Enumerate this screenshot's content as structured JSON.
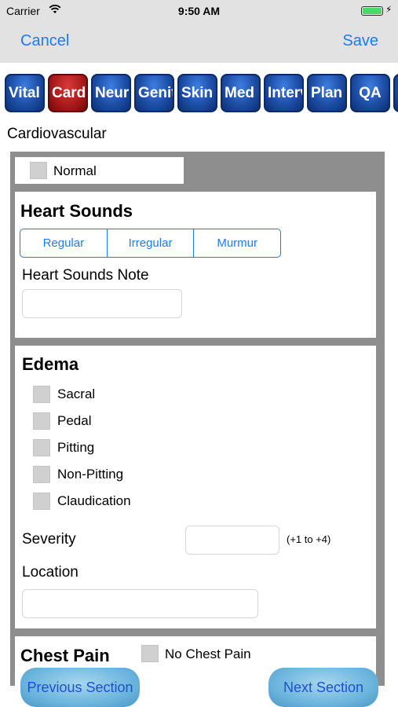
{
  "status_bar": {
    "carrier": "Carrier",
    "time": "9:50 AM",
    "battery_level": 1.0
  },
  "nav": {
    "cancel_label": "Cancel",
    "save_label": "Save"
  },
  "tabs": [
    {
      "label": "Vital",
      "active": false
    },
    {
      "label": "Cardi",
      "active": true
    },
    {
      "label": "Neuro",
      "active": false
    },
    {
      "label": "Genit",
      "active": false
    },
    {
      "label": "Skin",
      "active": false
    },
    {
      "label": "Med",
      "active": false
    },
    {
      "label": "Interv",
      "active": false
    },
    {
      "label": "Plan",
      "active": false
    },
    {
      "label": "QA",
      "active": false
    }
  ],
  "section_title": "Cardiovascular",
  "normal": {
    "label": "Normal",
    "checked": false
  },
  "heart_sounds": {
    "title": "Heart Sounds",
    "options": [
      "Regular",
      "Irregular",
      "Murmur"
    ],
    "note_label": "Heart Sounds Note",
    "note_value": ""
  },
  "edema": {
    "title": "Edema",
    "options": [
      "Sacral",
      "Pedal",
      "Pitting",
      "Non-Pitting",
      "Claudication"
    ],
    "severity_label": "Severity",
    "severity_value": "",
    "severity_hint": "(+1 to +4)",
    "location_label": "Location",
    "location_value": ""
  },
  "chest_pain": {
    "title": "Chest Pain",
    "no_pain_label": "No Chest Pain"
  },
  "footer": {
    "previous_label": "Previous Section",
    "next_label": "Next Section"
  },
  "colors": {
    "accent": "#1a7cf5",
    "tab_blue": "#1d4ea6",
    "tab_active_red": "#a81818",
    "panel_gray": "#8e8e8e"
  }
}
